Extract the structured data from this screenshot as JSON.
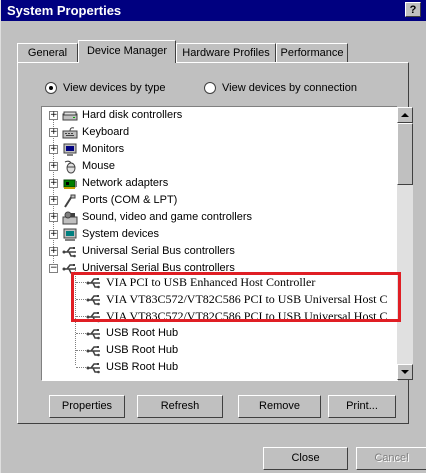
{
  "window": {
    "title": "System Properties",
    "help_label": "?"
  },
  "tabs": [
    {
      "label": "General"
    },
    {
      "label": "Device Manager"
    },
    {
      "label": "Hardware Profiles"
    },
    {
      "label": "Performance"
    }
  ],
  "view_options": {
    "by_type": "View devices by type",
    "by_connection": "View devices by connection",
    "selected": "by_type"
  },
  "tree": {
    "categories": [
      {
        "label": "Hard disk controllers",
        "icon": "hard-disk-icon",
        "expander": "+"
      },
      {
        "label": "Keyboard",
        "icon": "keyboard-icon",
        "expander": "+"
      },
      {
        "label": "Monitors",
        "icon": "monitor-icon",
        "expander": "+"
      },
      {
        "label": "Mouse",
        "icon": "mouse-icon",
        "expander": "+"
      },
      {
        "label": "Network adapters",
        "icon": "network-adapter-icon",
        "expander": "+"
      },
      {
        "label": "Ports (COM & LPT)",
        "icon": "port-icon",
        "expander": "+"
      },
      {
        "label": "Sound, video and game controllers",
        "icon": "sound-icon",
        "expander": "+"
      },
      {
        "label": "System devices",
        "icon": "system-device-icon",
        "expander": "+"
      },
      {
        "label": "Universal Serial Bus controllers",
        "icon": "usb-icon",
        "expander": "+"
      },
      {
        "label": "Universal Serial Bus controllers",
        "icon": "usb-icon",
        "expander": "−"
      }
    ],
    "usb_children": [
      {
        "label": "VIA PCI to USB Enhanced Host Controller",
        "icon": "usb-icon"
      },
      {
        "label": "VIA VT83C572/VT82C586 PCI to USB Universal Host C",
        "icon": "usb-icon"
      },
      {
        "label": "VIA VT83C572/VT82C586 PCI to USB Universal Host C",
        "icon": "usb-icon"
      },
      {
        "label": "USB Root Hub",
        "icon": "usb-icon"
      },
      {
        "label": "USB Root Hub",
        "icon": "usb-icon"
      },
      {
        "label": "USB Root Hub",
        "icon": "usb-icon"
      }
    ]
  },
  "buttons": {
    "properties": "Properties",
    "refresh": "Refresh",
    "remove": "Remove",
    "print": "Print...",
    "close": "Close",
    "cancel": "Cancel"
  },
  "colors": {
    "titlebar": "#000080",
    "highlight": "#e01e24",
    "face": "#c0c0c0"
  }
}
